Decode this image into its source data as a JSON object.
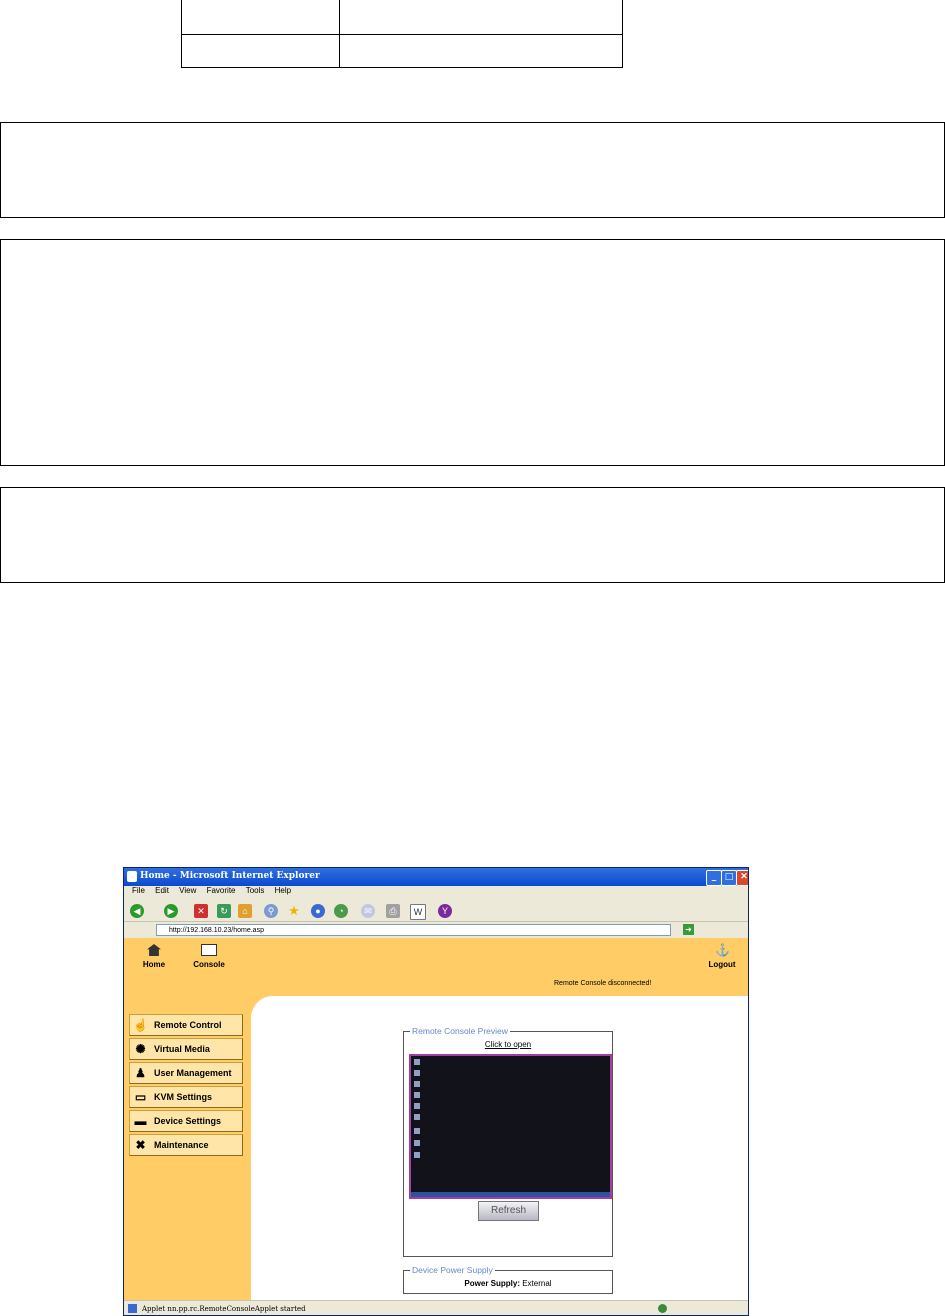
{
  "browser": {
    "title": "Home - Microsoft Internet Explorer",
    "menu": [
      "File",
      "Edit",
      "View",
      "Favorite",
      "Tools",
      "Help"
    ],
    "address": "http://192.168.10.23/home.asp",
    "status_text": "Applet nn.pp.rc.RemoteConsoleApplet started"
  },
  "topnav": {
    "home_label": "Home",
    "console_label": "Console",
    "status": "Remote Console disconnected!",
    "logout_label": "Logout"
  },
  "sidebar": {
    "items": [
      {
        "label": "Remote Control",
        "icon": "hand-icon"
      },
      {
        "label": "Virtual Media",
        "icon": "media-icon"
      },
      {
        "label": "User Management",
        "icon": "users-icon"
      },
      {
        "label": "KVM Settings",
        "icon": "monitor-icon"
      },
      {
        "label": "Device Settings",
        "icon": "device-icon"
      },
      {
        "label": "Maintenance",
        "icon": "tools-icon"
      }
    ]
  },
  "preview": {
    "legend": "Remote Console Preview",
    "link": "Click to open",
    "refresh_label": "Refresh"
  },
  "power": {
    "legend": "Device Power Supply",
    "key": "Power Supply:",
    "value": "External"
  }
}
